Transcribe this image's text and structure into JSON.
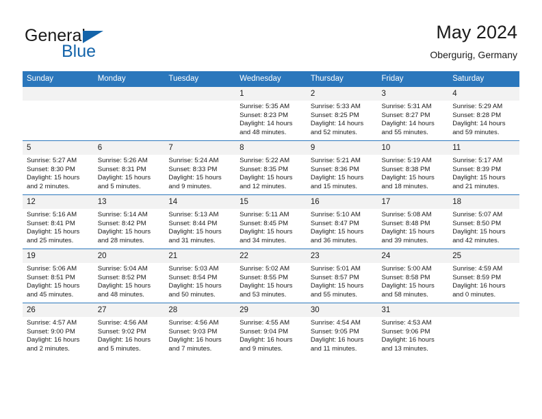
{
  "brand": {
    "name_part1": "General",
    "name_part2": "Blue",
    "logo_icon": "triangle-flag-icon",
    "accent_color": "#1464aa"
  },
  "header": {
    "title": "May 2024",
    "subtitle": "Obergurig, Germany"
  },
  "theme": {
    "header_bg": "#2b77bc",
    "header_text": "#ffffff",
    "daynum_bg": "#f2f2f2",
    "cell_bg": "#ffffff",
    "rule_color": "#2b77bc",
    "text_color": "#1a1a1a"
  },
  "weekday_headers": [
    "Sunday",
    "Monday",
    "Tuesday",
    "Wednesday",
    "Thursday",
    "Friday",
    "Saturday"
  ],
  "labels": {
    "sunrise": "Sunrise:",
    "sunset": "Sunset:",
    "daylight": "Daylight:"
  },
  "weeks": [
    [
      {
        "day": "",
        "blank": true
      },
      {
        "day": "",
        "blank": true
      },
      {
        "day": "",
        "blank": true
      },
      {
        "day": "1",
        "sunrise": "Sunrise: 5:35 AM",
        "sunset": "Sunset: 8:23 PM",
        "daylight1": "Daylight: 14 hours",
        "daylight2": "and 48 minutes."
      },
      {
        "day": "2",
        "sunrise": "Sunrise: 5:33 AM",
        "sunset": "Sunset: 8:25 PM",
        "daylight1": "Daylight: 14 hours",
        "daylight2": "and 52 minutes."
      },
      {
        "day": "3",
        "sunrise": "Sunrise: 5:31 AM",
        "sunset": "Sunset: 8:27 PM",
        "daylight1": "Daylight: 14 hours",
        "daylight2": "and 55 minutes."
      },
      {
        "day": "4",
        "sunrise": "Sunrise: 5:29 AM",
        "sunset": "Sunset: 8:28 PM",
        "daylight1": "Daylight: 14 hours",
        "daylight2": "and 59 minutes."
      }
    ],
    [
      {
        "day": "5",
        "sunrise": "Sunrise: 5:27 AM",
        "sunset": "Sunset: 8:30 PM",
        "daylight1": "Daylight: 15 hours",
        "daylight2": "and 2 minutes."
      },
      {
        "day": "6",
        "sunrise": "Sunrise: 5:26 AM",
        "sunset": "Sunset: 8:31 PM",
        "daylight1": "Daylight: 15 hours",
        "daylight2": "and 5 minutes."
      },
      {
        "day": "7",
        "sunrise": "Sunrise: 5:24 AM",
        "sunset": "Sunset: 8:33 PM",
        "daylight1": "Daylight: 15 hours",
        "daylight2": "and 9 minutes."
      },
      {
        "day": "8",
        "sunrise": "Sunrise: 5:22 AM",
        "sunset": "Sunset: 8:35 PM",
        "daylight1": "Daylight: 15 hours",
        "daylight2": "and 12 minutes."
      },
      {
        "day": "9",
        "sunrise": "Sunrise: 5:21 AM",
        "sunset": "Sunset: 8:36 PM",
        "daylight1": "Daylight: 15 hours",
        "daylight2": "and 15 minutes."
      },
      {
        "day": "10",
        "sunrise": "Sunrise: 5:19 AM",
        "sunset": "Sunset: 8:38 PM",
        "daylight1": "Daylight: 15 hours",
        "daylight2": "and 18 minutes."
      },
      {
        "day": "11",
        "sunrise": "Sunrise: 5:17 AM",
        "sunset": "Sunset: 8:39 PM",
        "daylight1": "Daylight: 15 hours",
        "daylight2": "and 21 minutes."
      }
    ],
    [
      {
        "day": "12",
        "sunrise": "Sunrise: 5:16 AM",
        "sunset": "Sunset: 8:41 PM",
        "daylight1": "Daylight: 15 hours",
        "daylight2": "and 25 minutes."
      },
      {
        "day": "13",
        "sunrise": "Sunrise: 5:14 AM",
        "sunset": "Sunset: 8:42 PM",
        "daylight1": "Daylight: 15 hours",
        "daylight2": "and 28 minutes."
      },
      {
        "day": "14",
        "sunrise": "Sunrise: 5:13 AM",
        "sunset": "Sunset: 8:44 PM",
        "daylight1": "Daylight: 15 hours",
        "daylight2": "and 31 minutes."
      },
      {
        "day": "15",
        "sunrise": "Sunrise: 5:11 AM",
        "sunset": "Sunset: 8:45 PM",
        "daylight1": "Daylight: 15 hours",
        "daylight2": "and 34 minutes."
      },
      {
        "day": "16",
        "sunrise": "Sunrise: 5:10 AM",
        "sunset": "Sunset: 8:47 PM",
        "daylight1": "Daylight: 15 hours",
        "daylight2": "and 36 minutes."
      },
      {
        "day": "17",
        "sunrise": "Sunrise: 5:08 AM",
        "sunset": "Sunset: 8:48 PM",
        "daylight1": "Daylight: 15 hours",
        "daylight2": "and 39 minutes."
      },
      {
        "day": "18",
        "sunrise": "Sunrise: 5:07 AM",
        "sunset": "Sunset: 8:50 PM",
        "daylight1": "Daylight: 15 hours",
        "daylight2": "and 42 minutes."
      }
    ],
    [
      {
        "day": "19",
        "sunrise": "Sunrise: 5:06 AM",
        "sunset": "Sunset: 8:51 PM",
        "daylight1": "Daylight: 15 hours",
        "daylight2": "and 45 minutes."
      },
      {
        "day": "20",
        "sunrise": "Sunrise: 5:04 AM",
        "sunset": "Sunset: 8:52 PM",
        "daylight1": "Daylight: 15 hours",
        "daylight2": "and 48 minutes."
      },
      {
        "day": "21",
        "sunrise": "Sunrise: 5:03 AM",
        "sunset": "Sunset: 8:54 PM",
        "daylight1": "Daylight: 15 hours",
        "daylight2": "and 50 minutes."
      },
      {
        "day": "22",
        "sunrise": "Sunrise: 5:02 AM",
        "sunset": "Sunset: 8:55 PM",
        "daylight1": "Daylight: 15 hours",
        "daylight2": "and 53 minutes."
      },
      {
        "day": "23",
        "sunrise": "Sunrise: 5:01 AM",
        "sunset": "Sunset: 8:57 PM",
        "daylight1": "Daylight: 15 hours",
        "daylight2": "and 55 minutes."
      },
      {
        "day": "24",
        "sunrise": "Sunrise: 5:00 AM",
        "sunset": "Sunset: 8:58 PM",
        "daylight1": "Daylight: 15 hours",
        "daylight2": "and 58 minutes."
      },
      {
        "day": "25",
        "sunrise": "Sunrise: 4:59 AM",
        "sunset": "Sunset: 8:59 PM",
        "daylight1": "Daylight: 16 hours",
        "daylight2": "and 0 minutes."
      }
    ],
    [
      {
        "day": "26",
        "sunrise": "Sunrise: 4:57 AM",
        "sunset": "Sunset: 9:00 PM",
        "daylight1": "Daylight: 16 hours",
        "daylight2": "and 2 minutes."
      },
      {
        "day": "27",
        "sunrise": "Sunrise: 4:56 AM",
        "sunset": "Sunset: 9:02 PM",
        "daylight1": "Daylight: 16 hours",
        "daylight2": "and 5 minutes."
      },
      {
        "day": "28",
        "sunrise": "Sunrise: 4:56 AM",
        "sunset": "Sunset: 9:03 PM",
        "daylight1": "Daylight: 16 hours",
        "daylight2": "and 7 minutes."
      },
      {
        "day": "29",
        "sunrise": "Sunrise: 4:55 AM",
        "sunset": "Sunset: 9:04 PM",
        "daylight1": "Daylight: 16 hours",
        "daylight2": "and 9 minutes."
      },
      {
        "day": "30",
        "sunrise": "Sunrise: 4:54 AM",
        "sunset": "Sunset: 9:05 PM",
        "daylight1": "Daylight: 16 hours",
        "daylight2": "and 11 minutes."
      },
      {
        "day": "31",
        "sunrise": "Sunrise: 4:53 AM",
        "sunset": "Sunset: 9:06 PM",
        "daylight1": "Daylight: 16 hours",
        "daylight2": "and 13 minutes."
      },
      {
        "day": "",
        "blank": true
      }
    ]
  ]
}
